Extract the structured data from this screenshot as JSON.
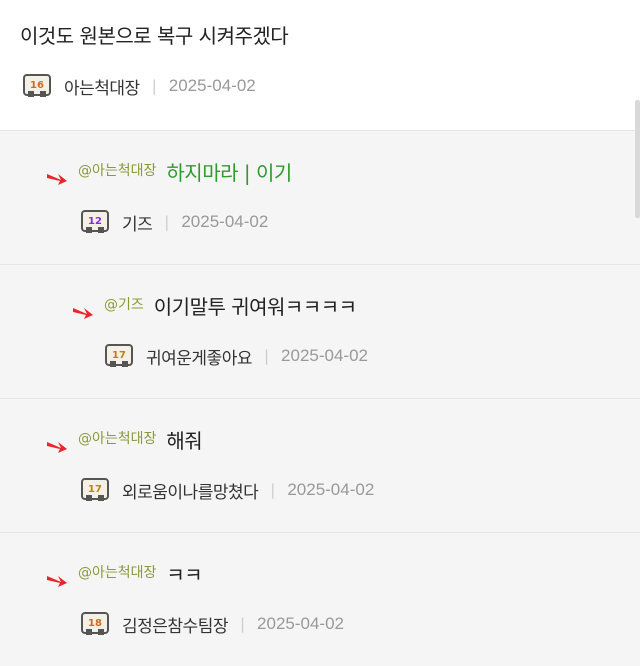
{
  "top_comment": {
    "text": "이것도 원본으로 복구 시켜주겠다",
    "author": "아는척대장",
    "level": "16",
    "date": "2025-04-02"
  },
  "replies": [
    {
      "mention": "@아는척대장",
      "text": "하지마라 | 이기",
      "author": "기즈",
      "level": "12",
      "date": "2025-04-02",
      "text_color": "#2f9b2f"
    },
    {
      "mention": "@기즈",
      "text": "이기말투 귀여워ㅋㅋㅋㅋ",
      "author": "귀여운게좋아요",
      "level": "17",
      "date": "2025-04-02"
    },
    {
      "mention": "@아는척대장",
      "text": "해줘",
      "author": "외로움이나를망쳤다",
      "level": "17",
      "date": "2025-04-02"
    },
    {
      "mention": "@아는척대장",
      "text": "ㅋㅋ",
      "author": "김정은참수팀장",
      "level": "18",
      "date": "2025-04-02"
    }
  ],
  "separator": "|",
  "colors": {
    "reply_bg": "#f5f5f5",
    "mention": "#8a9a3a",
    "arrow": "#e8262a"
  }
}
